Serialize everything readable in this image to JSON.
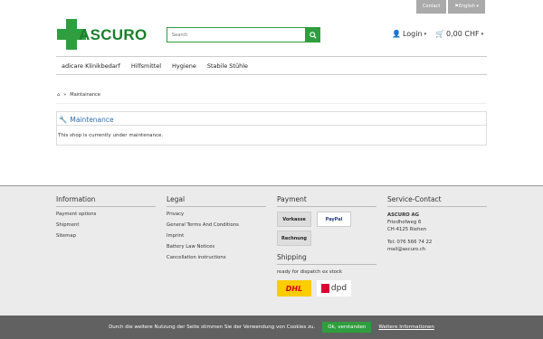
{
  "topbar": {
    "contact": "Contact",
    "language": "English"
  },
  "logo": {
    "text": "ASCURO"
  },
  "search": {
    "placeholder": "Search"
  },
  "account": {
    "login": "Login",
    "cart": "0,00 CHF"
  },
  "nav": [
    "adicare Klinikbedarf",
    "Hilfsmittel",
    "Hygiene",
    "Stabile Stühle"
  ],
  "breadcrumb": {
    "current": "Maintainance"
  },
  "panel": {
    "title": "Maintenance",
    "body": "This shop is currently under maintenance."
  },
  "footer": {
    "information": {
      "title": "Information",
      "links": [
        "Payment options",
        "Shipment",
        "Sitemap"
      ]
    },
    "legal": {
      "title": "Legal",
      "links": [
        "Privacy",
        "General Terms And Conditions",
        "Imprint",
        "Battery Law Notices",
        "Cancellation instructions"
      ]
    },
    "payment": {
      "title": "Payment",
      "methods": [
        "Vorkasse",
        "PayPal",
        "Rechnung"
      ]
    },
    "shipping": {
      "title": "Shipping",
      "note": "ready for dispatch ex stock",
      "carriers": [
        "DHL",
        "dpd"
      ]
    },
    "contact": {
      "title": "Service-Contact",
      "company": "ASCURO AG",
      "street": "Friedhofweg 6",
      "city": "CH-4125 Riehen",
      "tel": "Tel: 076 566 74 22",
      "mail": "mail@ascuro.ch"
    }
  },
  "cookie": {
    "text": "Durch die weitere Nutzung der Seite stimmen Sie der Verwendung von Cookies zu.",
    "ok": "Ok, verstanden",
    "more": "Weitere Informationen"
  }
}
